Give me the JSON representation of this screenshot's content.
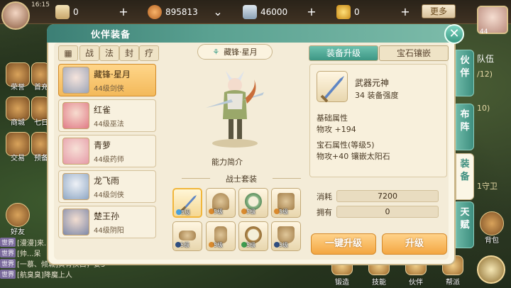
{
  "topbar": {
    "clock": "16:15",
    "resources": [
      {
        "icon": "scroll-icon",
        "value": "0"
      },
      {
        "icon": "copper-coin-icon",
        "value": "895813"
      },
      {
        "icon": "silver-scroll-icon",
        "value": "46000"
      },
      {
        "icon": "gold-ingot-icon",
        "value": "0"
      }
    ],
    "more_label": "更多"
  },
  "left_side_labels": [
    "荣誉",
    "首充",
    "商城",
    "七日",
    "交易",
    "预备",
    "好友"
  ],
  "chat": {
    "lines": [
      {
        "channel": "世界",
        "text": "[漫漫]来..."
      },
      {
        "channel": "世界",
        "text": "[帅...呆"
      },
      {
        "channel": "世界",
        "text": "[一慕、倾城]黄青换白，要3"
      },
      {
        "channel": "世界",
        "text": "[航臭臭]降魔上人"
      }
    ]
  },
  "panel": {
    "title": "伙伴装备",
    "close_label": "✕",
    "faction_tabs": [
      "战",
      "法",
      "封",
      "疗"
    ],
    "companions": [
      {
        "name": "藏锋·星月",
        "level": "44级剑侠",
        "selected": true
      },
      {
        "name": "红雀",
        "level": "44级巫法",
        "selected": false
      },
      {
        "name": "青萝",
        "level": "44级药师",
        "selected": false
      },
      {
        "name": "龙飞雨",
        "level": "44级剑侠",
        "selected": false
      },
      {
        "name": "楚王孙",
        "level": "44级阴阳",
        "selected": false
      }
    ],
    "character": {
      "name": "藏锋·星月",
      "ability_label": "能力简介"
    },
    "set": {
      "title": "战士套装",
      "items": [
        {
          "icon": "sword-icon",
          "level": "5级",
          "selected": true
        },
        {
          "icon": "helmet-icon",
          "level": "5级",
          "selected": false
        },
        {
          "icon": "necklace-icon",
          "level": "5级",
          "selected": false
        },
        {
          "icon": "armor-icon",
          "level": "5级",
          "selected": false
        },
        {
          "icon": "belt-icon",
          "level": "5级",
          "selected": false
        },
        {
          "icon": "bracer-icon",
          "level": "5级",
          "selected": false
        },
        {
          "icon": "ring-icon",
          "level": "5级",
          "selected": false
        },
        {
          "icon": "boots-icon",
          "level": "5级",
          "selected": false
        }
      ]
    },
    "right_tabs": {
      "upgrade": "装备升级",
      "gem": "宝石镶嵌"
    },
    "item_detail": {
      "name": "武器元神",
      "strength": "34 装备强度",
      "base_attr_title": "基础属性",
      "base_attr_value": "物攻 +194",
      "gem_attr_title": "宝石属性(等级5)",
      "gem_attr_value": "物攻+40 镶嵌太阳石"
    },
    "cost": {
      "label_cost": "消耗",
      "cost_value": "7200",
      "label_own": "拥有",
      "own_value": "0"
    },
    "buttons": {
      "one_key": "一键升级",
      "upgrade": "升级"
    },
    "side_tabs": [
      {
        "label": "伙伴",
        "active": false
      },
      {
        "label": "布阵",
        "active": false
      },
      {
        "label": "装备",
        "active": true
      },
      {
        "label": "天赋",
        "active": false
      }
    ]
  },
  "right_edge": {
    "level": "44",
    "lines": [
      "队伍",
      "/12)",
      "10)",
      "1守卫"
    ],
    "bag_label": "背包"
  },
  "bottom_nav": [
    "锻造",
    "技能",
    "伙伴",
    "帮派"
  ]
}
